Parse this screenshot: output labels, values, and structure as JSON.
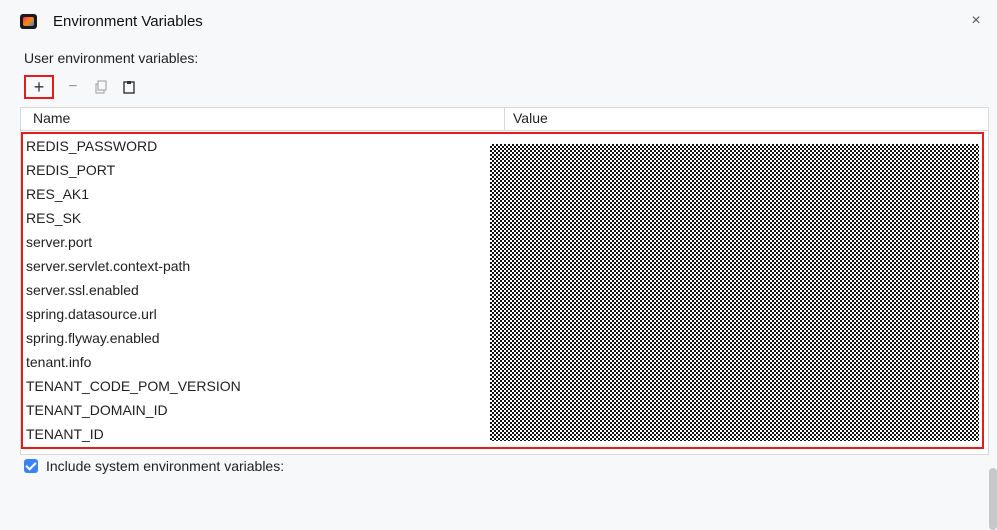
{
  "window": {
    "title": "Environment Variables",
    "close_glyph": "×"
  },
  "section": {
    "label": "User environment variables:"
  },
  "toolbar": {
    "add_glyph": "+",
    "remove_glyph": "−"
  },
  "table": {
    "columns": [
      "Name",
      "Value"
    ],
    "rows": [
      "REDIS_PASSWORD",
      "REDIS_PORT",
      "RES_AK1",
      "RES_SK",
      "server.port",
      "server.servlet.context-path",
      "server.ssl.enabled",
      "spring.datasource.url",
      "spring.flyway.enabled",
      "tenant.info",
      "TENANT_CODE_POM_VERSION",
      "TENANT_DOMAIN_ID",
      "TENANT_ID"
    ]
  },
  "footer": {
    "include_system_label": "Include system environment variables:",
    "include_system_checked": true
  },
  "colors": {
    "highlight": "#e11d1d",
    "checkbox": "#3b82f6",
    "background": "#f7f8fa"
  },
  "icons": {
    "app": "app-icon",
    "close": "close-icon",
    "add": "plus-icon",
    "remove": "minus-icon",
    "copy": "copy-icon",
    "paste": "paste-icon"
  }
}
